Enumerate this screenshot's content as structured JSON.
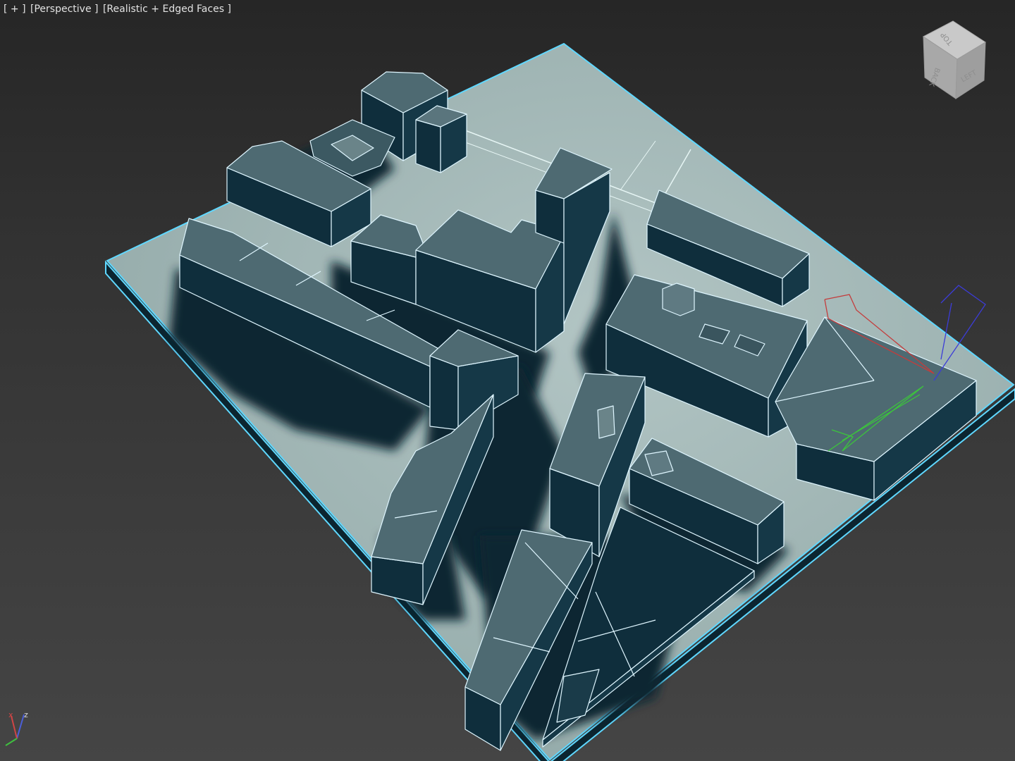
{
  "viewport": {
    "menu_plus": "[ + ]",
    "view_mode": "[Perspective ]",
    "shading_mode": "[Realistic + Edged Faces ]"
  },
  "viewcube": {
    "face_top": "TOP",
    "face_left": "LEFT",
    "face_back": "BACK"
  },
  "axis": {
    "z": "z",
    "x": "x"
  },
  "colors": {
    "background_top": "#262626",
    "background_bottom": "#454545",
    "ground": "#9fb4b3",
    "roof": "#4e6a72",
    "wall": "#0f2e3c",
    "shadow": "#0d2632",
    "edge": "#dff6ff",
    "selection_outline": "#5fd8ff",
    "gizmo_x": "#c43c3c",
    "gizmo_y": "#3cc43c",
    "gizmo_z": "#3c3cd8"
  }
}
